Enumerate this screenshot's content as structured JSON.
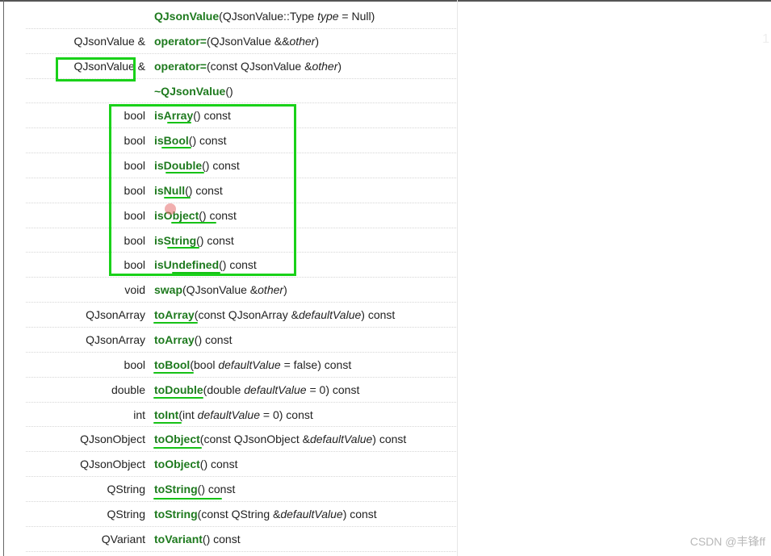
{
  "rows": [
    {
      "ret": "",
      "name": "QJsonValue",
      "pre": "(QJsonValue::Type ",
      "arg": "type",
      "post": " = Null)"
    },
    {
      "ret": "QJsonValue &",
      "name": "operator=",
      "pre": "(QJsonValue &&",
      "arg": "other",
      "post": ")"
    },
    {
      "ret": "QJsonValue &",
      "name": "operator=",
      "pre": "(const QJsonValue &",
      "arg": "other",
      "post": ")"
    },
    {
      "ret": "",
      "name": "~QJsonValue",
      "pre": "()",
      "arg": "",
      "post": ""
    },
    {
      "ret": "bool",
      "name": "isArray",
      "pre": "() const",
      "arg": "",
      "post": ""
    },
    {
      "ret": "bool",
      "name": "isBool",
      "pre": "() const",
      "arg": "",
      "post": ""
    },
    {
      "ret": "bool",
      "name": "isDouble",
      "pre": "() const",
      "arg": "",
      "post": ""
    },
    {
      "ret": "bool",
      "name": "isNull",
      "pre": "() const",
      "arg": "",
      "post": ""
    },
    {
      "ret": "bool",
      "name": "isObject",
      "pre": "() const",
      "arg": "",
      "post": ""
    },
    {
      "ret": "bool",
      "name": "isString",
      "pre": "() const",
      "arg": "",
      "post": ""
    },
    {
      "ret": "bool",
      "name": "isUndefined",
      "pre": "() const",
      "arg": "",
      "post": ""
    },
    {
      "ret": "void",
      "name": "swap",
      "pre": "(QJsonValue &",
      "arg": "other",
      "post": ")"
    },
    {
      "ret": "QJsonArray",
      "name": "toArray",
      "pre": "(const QJsonArray &",
      "arg": "defaultValue",
      "post": ") const"
    },
    {
      "ret": "QJsonArray",
      "name": "toArray",
      "pre": "() const",
      "arg": "",
      "post": ""
    },
    {
      "ret": "bool",
      "name": "toBool",
      "pre": "(bool ",
      "arg": "defaultValue",
      "post": " = false) const"
    },
    {
      "ret": "double",
      "name": "toDouble",
      "pre": "(double ",
      "arg": "defaultValue",
      "post": " = 0) const"
    },
    {
      "ret": "int",
      "name": "toInt",
      "pre": "(int ",
      "arg": "defaultValue",
      "post": " = 0) const"
    },
    {
      "ret": "QJsonObject",
      "name": "toObject",
      "pre": "(const QJsonObject &",
      "arg": "defaultValue",
      "post": ") const"
    },
    {
      "ret": "QJsonObject",
      "name": "toObject",
      "pre": "() const",
      "arg": "",
      "post": ""
    },
    {
      "ret": "QString",
      "name": "toString",
      "pre": "() const",
      "arg": "",
      "post": ""
    },
    {
      "ret": "QString",
      "name": "toString",
      "pre": "(const QString &",
      "arg": "defaultValue",
      "post": ") const"
    },
    {
      "ret": "QVariant",
      "name": "toVariant",
      "pre": "() const",
      "arg": "",
      "post": ""
    }
  ],
  "watermark": "CSDN @丰锋ff",
  "colors": {
    "function_name": "#1e7a1e",
    "annotation": "#19d119"
  }
}
